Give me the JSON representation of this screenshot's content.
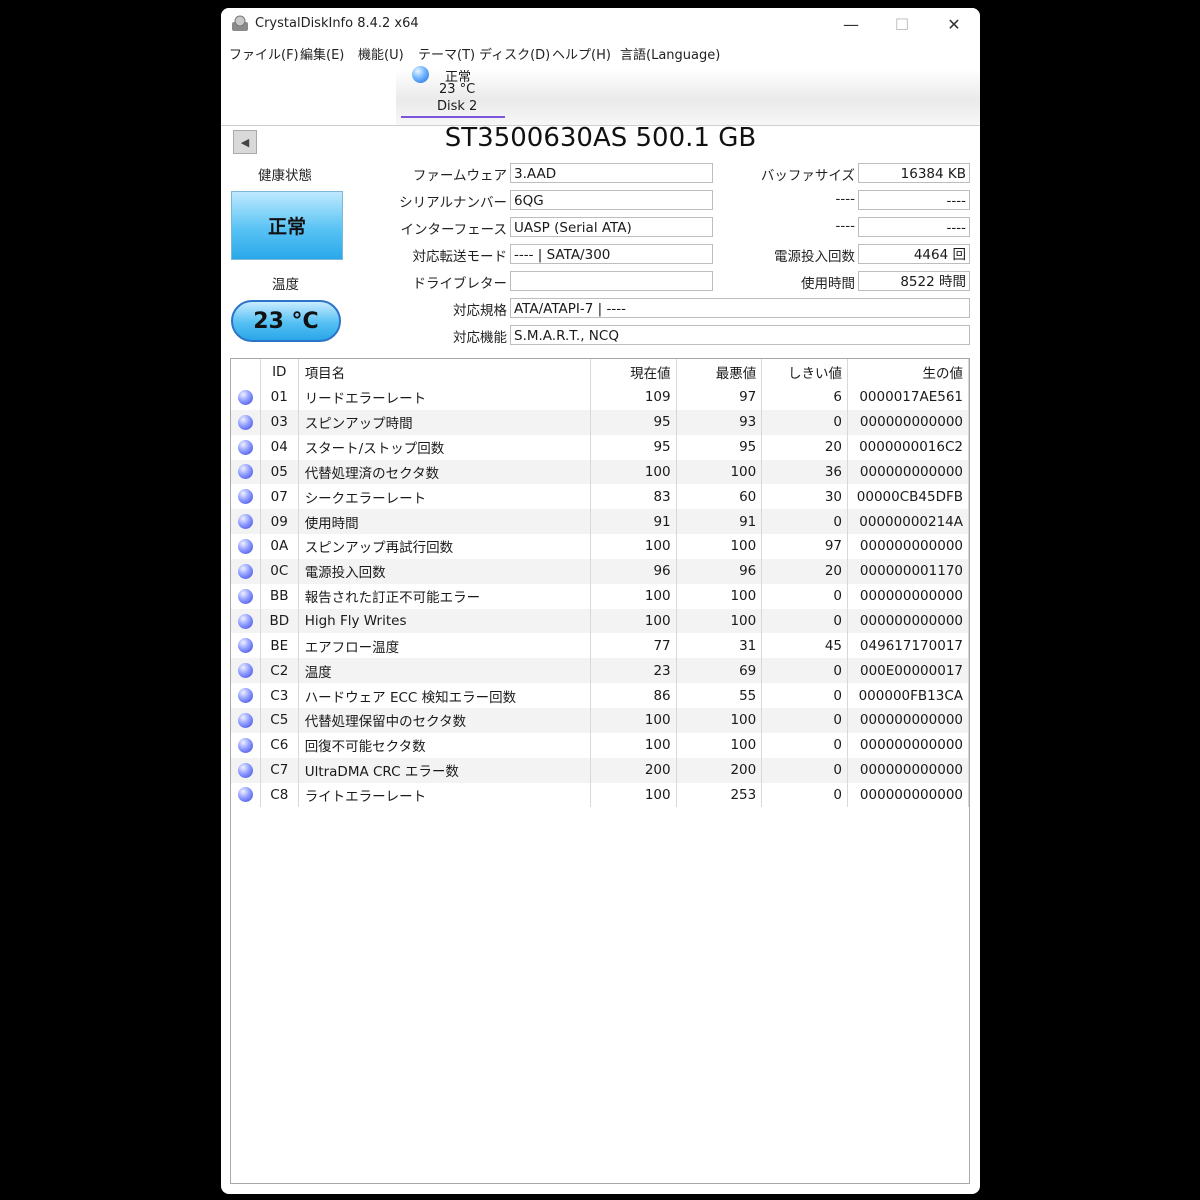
{
  "window": {
    "title": "CrystalDiskInfo 8.4.2 x64",
    "minimize": "—",
    "maximize": "☐",
    "close": "✕"
  },
  "menu": [
    "ファイル(F)",
    "編集(E)",
    "機能(U)",
    "テーマ(T)",
    "ディスク(D)",
    "ヘルプ(H)",
    "言語(Language)"
  ],
  "disk_tab": {
    "status": "正常",
    "temp": "23 °C",
    "name": "Disk 2"
  },
  "model": "ST3500630AS 500.1 GB",
  "health": {
    "label": "健康状態",
    "value": "正常",
    "color": "#59c3f4"
  },
  "temperature": {
    "label": "温度",
    "value": "23 °C"
  },
  "info": {
    "firmware_label": "ファームウェア",
    "firmware": "3.AAD",
    "serial_label": "シリアルナンバー",
    "serial": "6QG",
    "interface_label": "インターフェース",
    "interface": "UASP (Serial ATA)",
    "transfer_label": "対応転送モード",
    "transfer": "---- | SATA/300",
    "drive_letter_label": "ドライブレター",
    "drive_letter": "",
    "standard_label": "対応規格",
    "standard": "ATA/ATAPI-7 | ----",
    "features_label": "対応機能",
    "features": "S.M.A.R.T., NCQ",
    "buffer_label": "バッファサイズ",
    "buffer": "16384 KB",
    "r2_label": "----",
    "r2": "----",
    "r3_label": "----",
    "r3": "----",
    "power_count_label": "電源投入回数",
    "power_count": "4464 回",
    "hours_label": "使用時間",
    "hours": "8522 時間"
  },
  "smart": {
    "headers": {
      "id": "ID",
      "name": "項目名",
      "current": "現在値",
      "worst": "最悪値",
      "threshold": "しきい値",
      "raw": "生の値"
    },
    "rows": [
      {
        "id": "01",
        "name": "リードエラーレート",
        "current": "109",
        "worst": "97",
        "threshold": "6",
        "raw": "0000017AE561"
      },
      {
        "id": "03",
        "name": "スピンアップ時間",
        "current": "95",
        "worst": "93",
        "threshold": "0",
        "raw": "000000000000"
      },
      {
        "id": "04",
        "name": "スタート/ストップ回数",
        "current": "95",
        "worst": "95",
        "threshold": "20",
        "raw": "0000000016C2"
      },
      {
        "id": "05",
        "name": "代替処理済のセクタ数",
        "current": "100",
        "worst": "100",
        "threshold": "36",
        "raw": "000000000000"
      },
      {
        "id": "07",
        "name": "シークエラーレート",
        "current": "83",
        "worst": "60",
        "threshold": "30",
        "raw": "00000CB45DFB"
      },
      {
        "id": "09",
        "name": "使用時間",
        "current": "91",
        "worst": "91",
        "threshold": "0",
        "raw": "00000000214A"
      },
      {
        "id": "0A",
        "name": "スピンアップ再試行回数",
        "current": "100",
        "worst": "100",
        "threshold": "97",
        "raw": "000000000000"
      },
      {
        "id": "0C",
        "name": "電源投入回数",
        "current": "96",
        "worst": "96",
        "threshold": "20",
        "raw": "000000001170"
      },
      {
        "id": "BB",
        "name": "報告された訂正不可能エラー",
        "current": "100",
        "worst": "100",
        "threshold": "0",
        "raw": "000000000000"
      },
      {
        "id": "BD",
        "name": "High Fly Writes",
        "current": "100",
        "worst": "100",
        "threshold": "0",
        "raw": "000000000000"
      },
      {
        "id": "BE",
        "name": "エアフロー温度",
        "current": "77",
        "worst": "31",
        "threshold": "45",
        "raw": "049617170017"
      },
      {
        "id": "C2",
        "name": "温度",
        "current": "23",
        "worst": "69",
        "threshold": "0",
        "raw": "000E00000017"
      },
      {
        "id": "C3",
        "name": "ハードウェア ECC 検知エラー回数",
        "current": "86",
        "worst": "55",
        "threshold": "0",
        "raw": "000000FB13CA"
      },
      {
        "id": "C5",
        "name": "代替処理保留中のセクタ数",
        "current": "100",
        "worst": "100",
        "threshold": "0",
        "raw": "000000000000"
      },
      {
        "id": "C6",
        "name": "回復不可能セクタ数",
        "current": "100",
        "worst": "100",
        "threshold": "0",
        "raw": "000000000000"
      },
      {
        "id": "C7",
        "name": "UltraDMA CRC エラー数",
        "current": "200",
        "worst": "200",
        "threshold": "0",
        "raw": "000000000000"
      },
      {
        "id": "C8",
        "name": "ライトエラーレート",
        "current": "100",
        "worst": "253",
        "threshold": "0",
        "raw": "000000000000"
      }
    ]
  }
}
